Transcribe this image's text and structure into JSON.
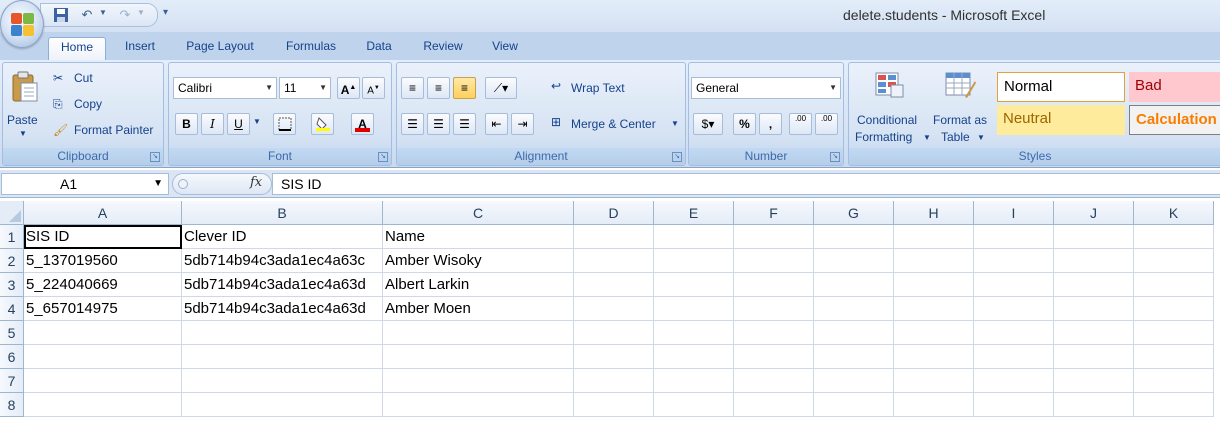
{
  "window": {
    "title": "delete.students - Microsoft Excel"
  },
  "qat": {
    "icons": [
      "save-icon",
      "undo-icon",
      "redo-icon",
      "customize-icon"
    ]
  },
  "tabs": [
    {
      "label": "Home",
      "active": true
    },
    {
      "label": "Insert"
    },
    {
      "label": "Page Layout"
    },
    {
      "label": "Formulas"
    },
    {
      "label": "Data"
    },
    {
      "label": "Review"
    },
    {
      "label": "View"
    }
  ],
  "ribbon": {
    "clipboard": {
      "label": "Clipboard",
      "paste": "Paste",
      "cut": "Cut",
      "copy": "Copy",
      "format_painter": "Format Painter"
    },
    "font": {
      "label": "Font",
      "font_name": "Calibri",
      "font_size": "11",
      "bold": "B",
      "italic": "I",
      "underline": "U",
      "grow": "A",
      "shrink": "A",
      "font_color": "A"
    },
    "alignment": {
      "label": "Alignment",
      "wrap_text": "Wrap Text",
      "merge_center": "Merge & Center"
    },
    "number": {
      "label": "Number",
      "format": "General",
      "percent": "%",
      "comma": ",",
      "inc_decimal": ".00",
      "dec_decimal": ".00"
    },
    "styles": {
      "label": "Styles",
      "conditional_formatting": [
        "Conditional",
        "Formatting"
      ],
      "format_as_table": [
        "Format as",
        "Table"
      ],
      "normal": "Normal",
      "bad": "Bad",
      "neutral": "Neutral",
      "calculation": "Calculation"
    }
  },
  "formula_bar": {
    "name_box": "A1",
    "fx": "fx",
    "content": "SIS ID"
  },
  "sheet": {
    "columns": [
      "A",
      "B",
      "C",
      "D",
      "E",
      "F",
      "G",
      "H",
      "I",
      "J",
      "K"
    ],
    "rows": [
      "1",
      "2",
      "3",
      "4",
      "5",
      "6",
      "7",
      "8"
    ],
    "cells": [
      [
        "SIS ID",
        "Clever ID",
        "Name"
      ],
      [
        "5_137019560",
        "5db714b94c3ada1ec4a63c",
        "Amber Wisoky"
      ],
      [
        "5_224040669",
        "5db714b94c3ada1ec4a63d",
        "Albert Larkin"
      ],
      [
        "5_657014975",
        "5db714b94c3ada1ec4a63d",
        "Amber Moen"
      ]
    ]
  },
  "colors": {
    "ribbon_blue": "#bfd3ec",
    "bad_bg": "#ffc7ce",
    "neutral_bg": "#ffeb9c",
    "calc_text": "#fa7d00"
  }
}
